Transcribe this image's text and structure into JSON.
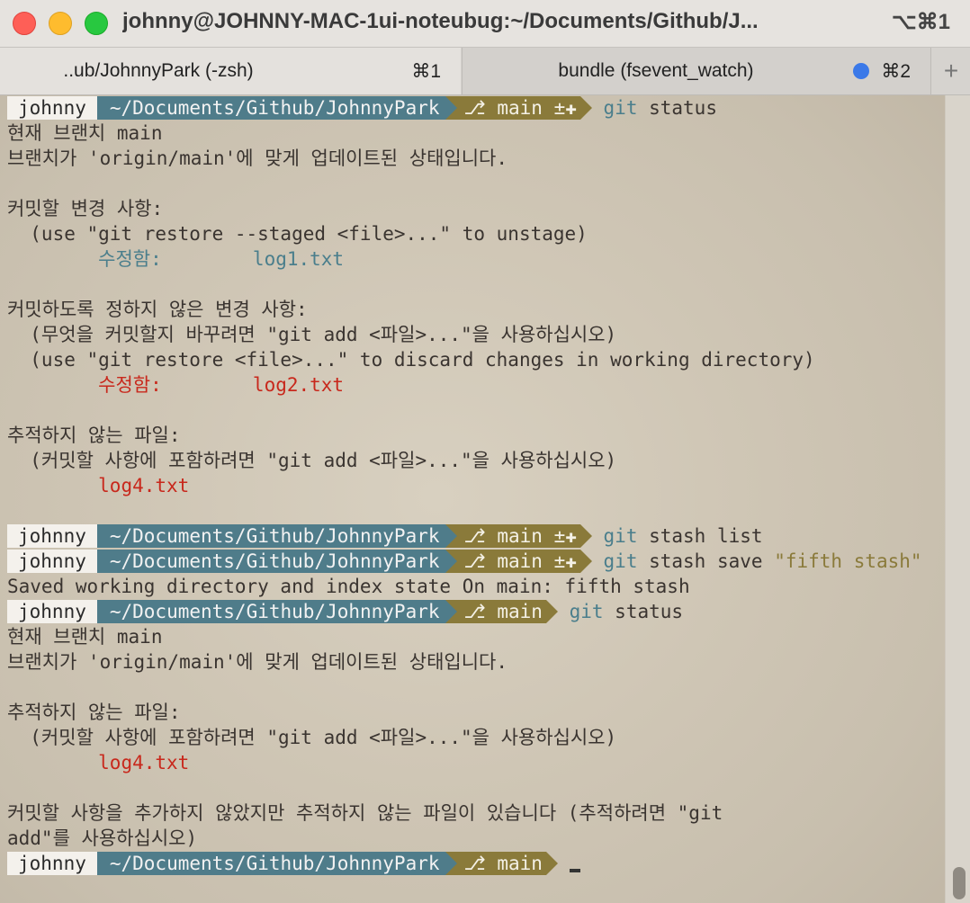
{
  "window": {
    "title": "johnny@JOHNNY-MAC-1ui-noteubug:~/Documents/Github/J...",
    "shortcut": "⌥⌘1"
  },
  "tabs": [
    {
      "label": "..ub/JohnnyPark (-zsh)",
      "shortcut": "⌘1"
    },
    {
      "label": "bundle (fsevent_watch)",
      "shortcut": "⌘2"
    }
  ],
  "new_tab_symbol": "+",
  "prompt": {
    "user": "johnny",
    "path": "~/Documents/Github/JohnnyPark",
    "branch_dirty": "main ±✚",
    "branch_clean": "main",
    "branch_icon": "branch-icon"
  },
  "terminal": {
    "cmd1_git": "git",
    "cmd1_rest": " status",
    "out1": [
      "현재 브랜치 main",
      "브랜치가 'origin/main'에 맞게 업데이트된 상태입니다.",
      "",
      "커밋할 변경 사항:",
      "  (use \"git restore --staged <file>...\" to unstage)"
    ],
    "staged_label": "수정함:",
    "staged_file": "log1.txt",
    "out2": [
      "",
      "커밋하도록 정하지 않은 변경 사항:",
      "  (무엇을 커밋할지 바꾸려면 \"git add <파일>...\"을 사용하십시오)",
      "  (use \"git restore <file>...\" to discard changes in working directory)"
    ],
    "unstaged_label": "수정함:",
    "unstaged_file": "log2.txt",
    "out3": [
      "",
      "추적하지 않는 파일:",
      "  (커밋할 사항에 포함하려면 \"git add <파일>...\"을 사용하십시오)"
    ],
    "untracked_file": "log4.txt",
    "cmd2_git": "git",
    "cmd2_rest": " stash list",
    "cmd3_git": "git",
    "cmd3_rest": " stash save ",
    "cmd3_str": "\"fifth stash\"",
    "out_saved": "Saved working directory and index state On main: fifth stash",
    "cmd4_git": "git",
    "cmd4_rest": " status",
    "out4": [
      "현재 브랜치 main",
      "브랜치가 'origin/main'에 맞게 업데이트된 상태입니다.",
      "",
      "추적하지 않는 파일:",
      "  (커밋할 사항에 포함하려면 \"git add <파일>...\"을 사용하십시오)"
    ],
    "untracked_file2": "log4.txt",
    "out5": [
      "",
      "커밋할 사항을 추가하지 않았지만 추적하지 않는 파일이 있습니다 (추적하려면 \"git",
      "add\"를 사용하십시오)"
    ]
  },
  "colors": {
    "path_bg": "#4f7c8a",
    "branch_bg": "#8a7a3a",
    "red": "#c8281c",
    "blue": "#4a7e8c"
  }
}
